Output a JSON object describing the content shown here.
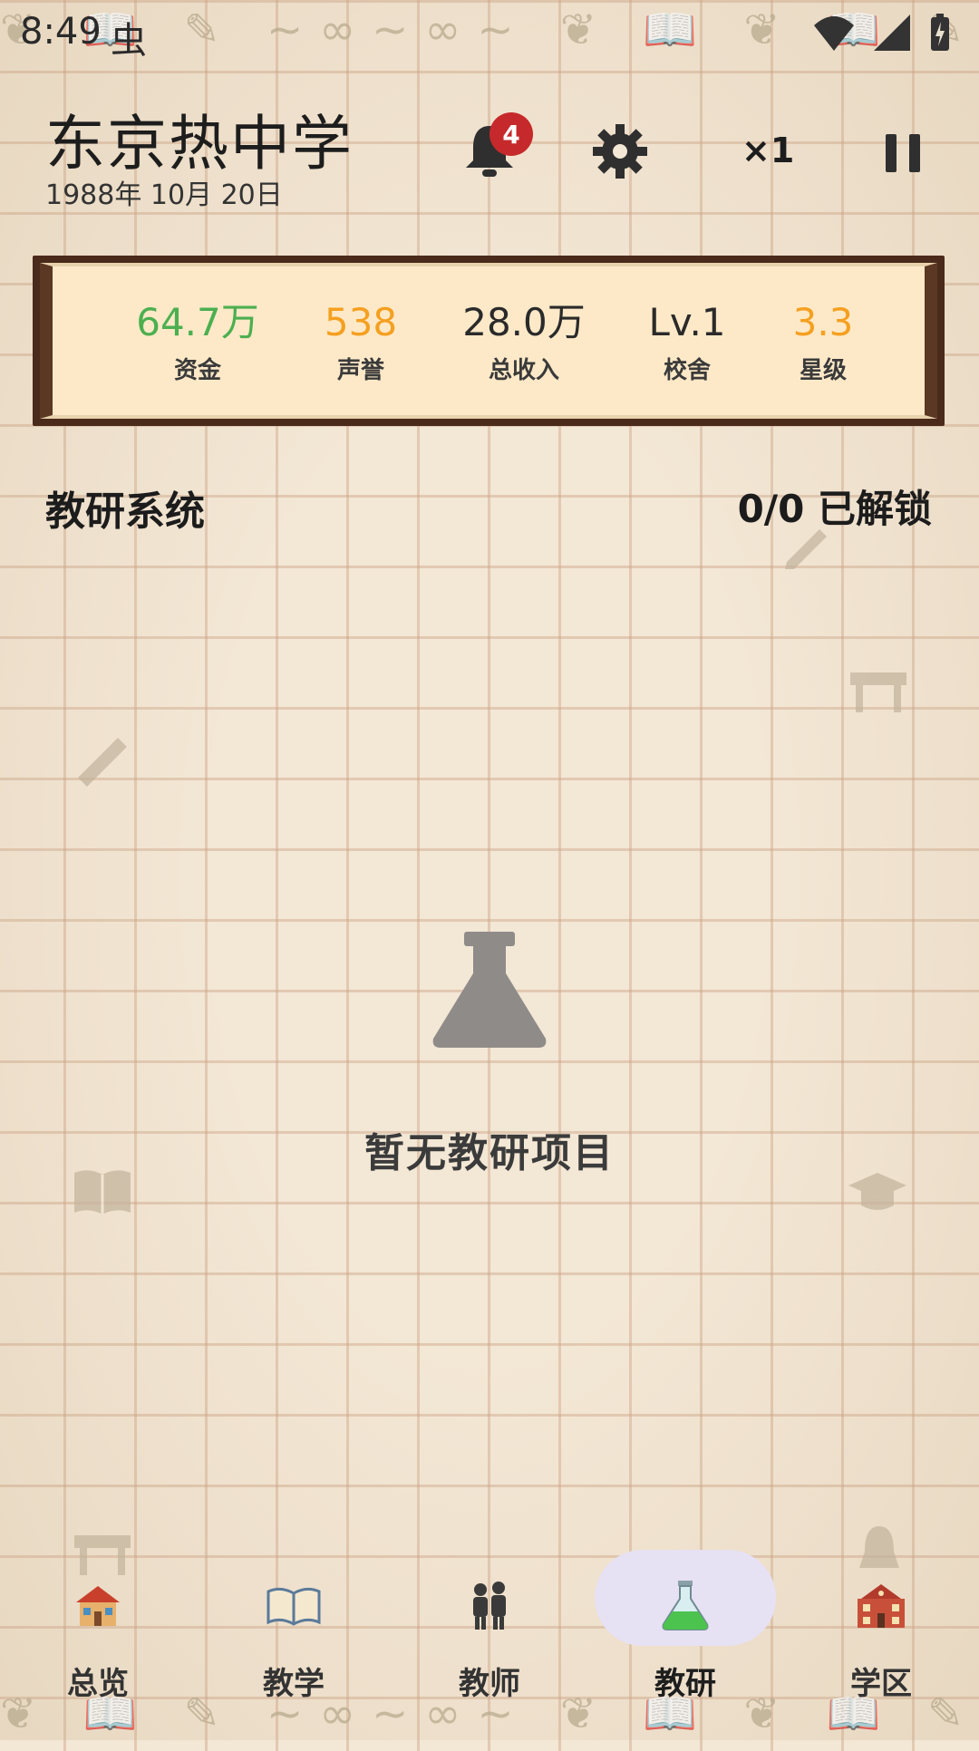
{
  "status_bar": {
    "time": "8:49",
    "bug_icon": "虫"
  },
  "header": {
    "school_name": "东京热中学",
    "date": "1988年 10月 20日",
    "notification_count": "4",
    "speed_label": "×1"
  },
  "stats": [
    {
      "value": "64.7万",
      "label": "资金",
      "color": "#4caf50"
    },
    {
      "value": "538",
      "label": "声誉",
      "color": "#f5a020"
    },
    {
      "value": "28.0万",
      "label": "总收入",
      "color": "#2a2a2a"
    },
    {
      "value": "Lv.1",
      "label": "校舍",
      "color": "#2a2a2a"
    },
    {
      "value": "3.3",
      "label": "星级",
      "color": "#f5a020"
    }
  ],
  "section": {
    "title": "教研系统",
    "unlock_status": "0/0 已解锁"
  },
  "empty_state": {
    "icon": "flask-icon",
    "text": "暂无教研项目"
  },
  "nav": {
    "active_index": 3,
    "active_pill_color": "#e7e1f4",
    "items": [
      {
        "label": "总览",
        "icon": "school-house-icon"
      },
      {
        "label": "教学",
        "icon": "book-icon"
      },
      {
        "label": "教师",
        "icon": "teachers-icon"
      },
      {
        "label": "教研",
        "icon": "flask-icon"
      },
      {
        "label": "学区",
        "icon": "school-building-icon"
      }
    ]
  }
}
